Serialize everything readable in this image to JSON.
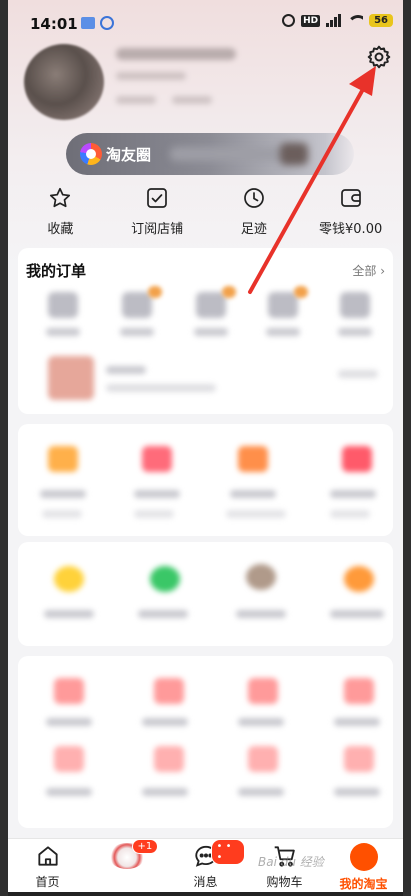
{
  "status_bar": {
    "time": "14:01",
    "hd": "HD",
    "battery": "56"
  },
  "profile": {
    "settings_icon": "gear-icon"
  },
  "friends": {
    "label": "淘友圈"
  },
  "quick_actions": [
    {
      "icon": "star-icon",
      "label": "收藏"
    },
    {
      "icon": "store-check-icon",
      "label": "订阅店铺"
    },
    {
      "icon": "clock-icon",
      "label": "足迹"
    },
    {
      "icon": "wallet-icon",
      "label": "零钱¥0.00"
    }
  ],
  "orders": {
    "title": "我的订单",
    "all_label": "全部 ›"
  },
  "tab_bar": {
    "items": [
      {
        "label": "首页",
        "icon": "home-icon"
      },
      {
        "label": "",
        "icon": "promo-image-icon",
        "badge": "+1"
      },
      {
        "label": "消息",
        "icon": "message-icon",
        "badge": "• • •"
      },
      {
        "label": "购物车",
        "icon": "cart-icon"
      },
      {
        "label": "我的淘宝",
        "icon": "profile-circle-icon"
      }
    ]
  },
  "watermark": "Bai du 经验",
  "colors": {
    "accent": "#ff5000",
    "annotation_arrow": "#e8322a"
  }
}
